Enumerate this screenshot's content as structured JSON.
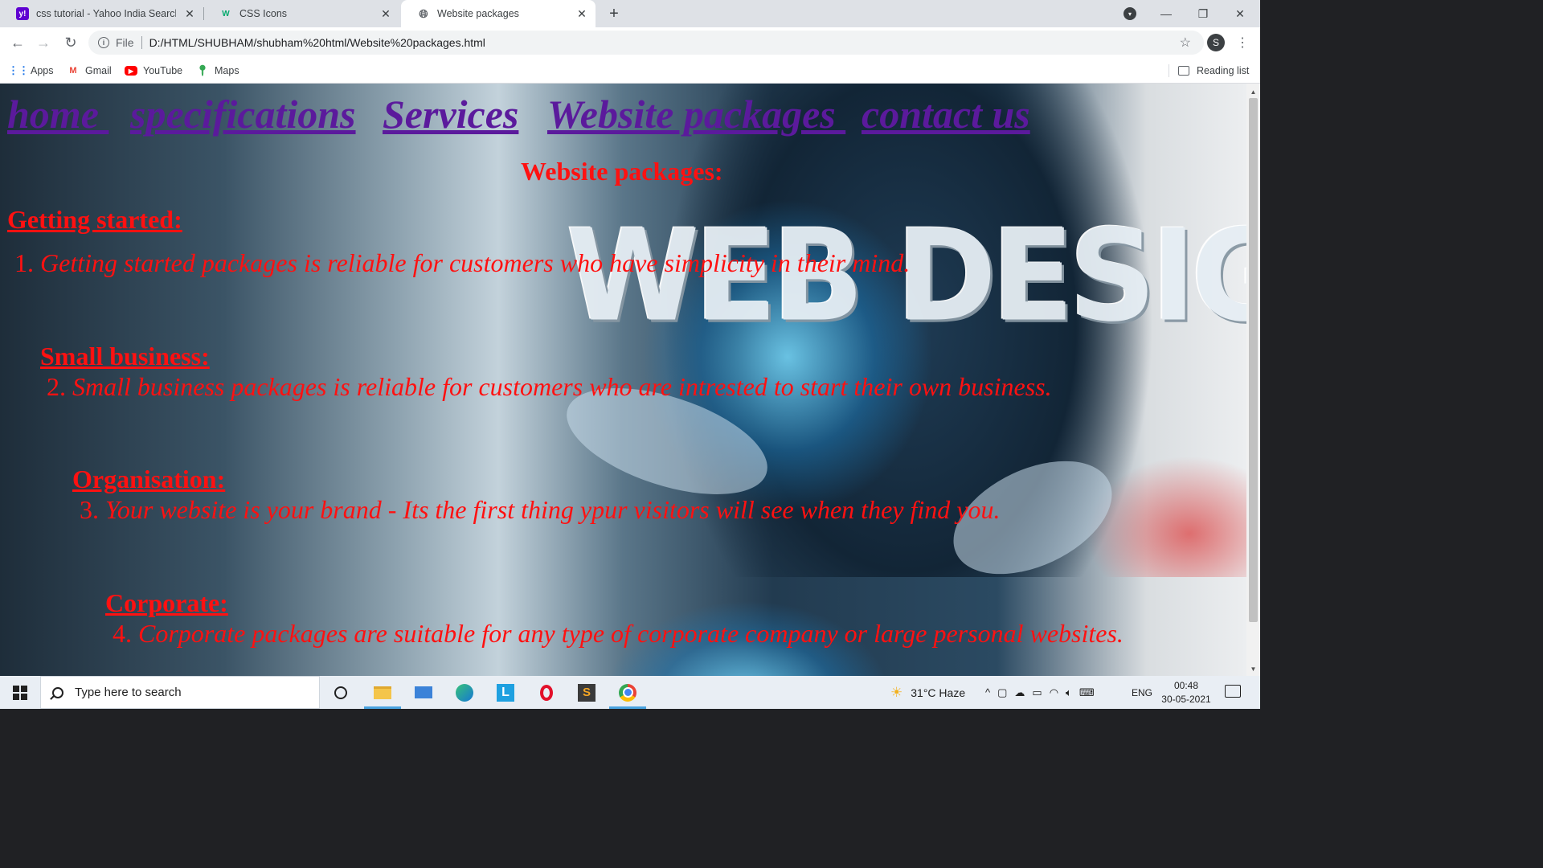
{
  "browser": {
    "tabs": [
      {
        "title": "css tutorial - Yahoo India Search Results",
        "favicon": "yahoo-icon",
        "active": false
      },
      {
        "title": "CSS Icons",
        "favicon": "w3schools-icon",
        "active": false
      },
      {
        "title": "Website packages",
        "favicon": "globe-icon",
        "active": true
      }
    ],
    "address": {
      "scheme_label": "File",
      "url": "D:/HTML/SHUBHAM/shubham%20html/Website%20packages.html"
    },
    "profile_initial": "S",
    "bookmarks": [
      {
        "label": "Apps",
        "icon": "apps-grid-icon"
      },
      {
        "label": "Gmail",
        "icon": "gmail-icon"
      },
      {
        "label": "YouTube",
        "icon": "youtube-icon"
      },
      {
        "label": "Maps",
        "icon": "maps-icon"
      }
    ],
    "reading_list_label": "Reading list"
  },
  "page": {
    "nav": [
      "home ",
      "specifications",
      "Services",
      "Website packages ",
      "contact us"
    ],
    "heading": "Website packages:",
    "background_art_text": "WEB DESIGN",
    "sections": [
      {
        "title": "Getting started:",
        "number": "1.",
        "text": "Getting started packages is reliable for customers who have simplicity in their mind."
      },
      {
        "title": "Small business:",
        "number": "2.",
        "text": "Small business packages is reliable for customers who are intrested to start their own business."
      },
      {
        "title": "Organisation:",
        "number": "3.",
        "text": "Your website is your brand - Its the first thing ypur visitors will see when they find you."
      },
      {
        "title": "Corporate:",
        "number": "4.",
        "text": "Corporate packages are suitable for any type of corporate company or large personal websites."
      }
    ]
  },
  "taskbar": {
    "search_placeholder": "Type here to search",
    "weather": "31°C  Haze",
    "language": "ENG",
    "time": "00:48",
    "date": "30-05-2021"
  },
  "colors": {
    "nav_link": "#5b1a9c",
    "content_text": "#ff1111",
    "chrome_tabstrip": "#dee1e6"
  }
}
